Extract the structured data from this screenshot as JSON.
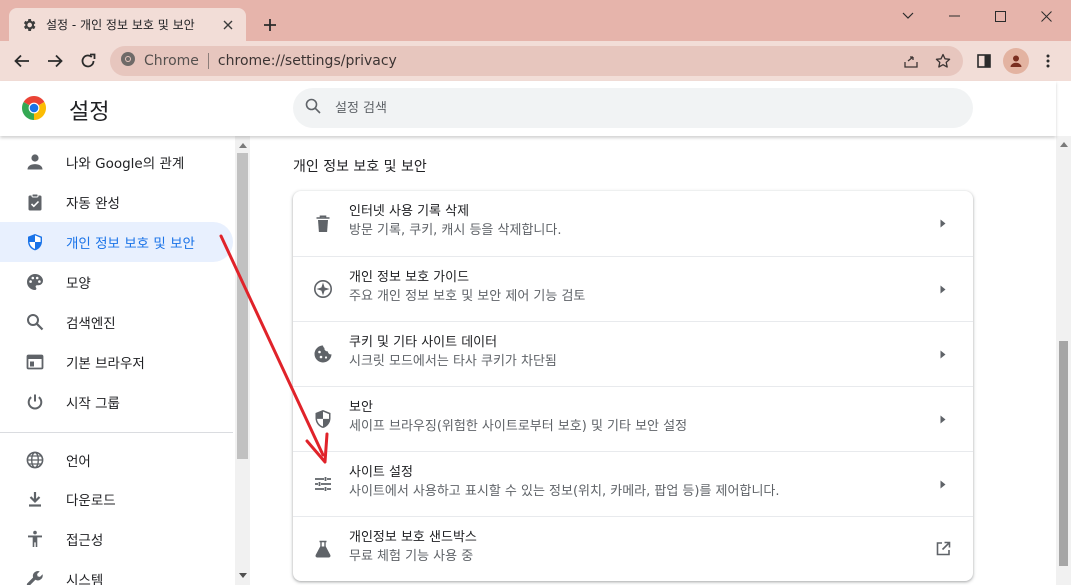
{
  "tab": {
    "title": "설정 - 개인 정보 보호 및 보안",
    "icon": "gear-icon"
  },
  "window_controls": [
    "chevron-down-icon",
    "minimize-icon",
    "maximize-icon",
    "close-icon"
  ],
  "toolbar": {
    "site_label": "Chrome",
    "url": "chrome://settings/privacy"
  },
  "header": {
    "title": "설정",
    "search_placeholder": "설정 검색"
  },
  "sidebar": {
    "items": [
      {
        "label": "나와 Google의 관계",
        "icon": "person-icon",
        "active": false
      },
      {
        "label": "자동 완성",
        "icon": "clipboard-icon",
        "active": false
      },
      {
        "label": "개인 정보 보호 및 보안",
        "icon": "shield-icon",
        "active": true
      },
      {
        "label": "모양",
        "icon": "palette-icon",
        "active": false
      },
      {
        "label": "검색엔진",
        "icon": "search-icon",
        "active": false
      },
      {
        "label": "기본 브라우저",
        "icon": "browser-icon",
        "active": false
      },
      {
        "label": "시작 그룹",
        "icon": "power-icon",
        "active": false
      },
      {
        "label": "언어",
        "icon": "globe-icon",
        "active": false
      },
      {
        "label": "다운로드",
        "icon": "download-icon",
        "active": false
      },
      {
        "label": "접근성",
        "icon": "accessibility-icon",
        "active": false
      },
      {
        "label": "시스템",
        "icon": "wrench-icon",
        "active": false
      }
    ]
  },
  "main": {
    "section_title": "개인 정보 보호 및 보안",
    "rows": [
      {
        "title": "인터넷 사용 기록 삭제",
        "subtitle": "방문 기록, 쿠키, 캐시 등을 삭제합니다.",
        "icon": "trash-icon",
        "action": "arrow"
      },
      {
        "title": "개인 정보 보호 가이드",
        "subtitle": "주요 개인 정보 보호 및 보안 제어 기능 검토",
        "icon": "compass-icon",
        "action": "arrow"
      },
      {
        "title": "쿠키 및 기타 사이트 데이터",
        "subtitle": "시크릿 모드에서는 타사 쿠키가 차단됨",
        "icon": "cookie-icon",
        "action": "arrow"
      },
      {
        "title": "보안",
        "subtitle": "세이프 브라우징(위험한 사이트로부터 보호) 및 기타 보안 설정",
        "icon": "shield-icon",
        "action": "arrow"
      },
      {
        "title": "사이트 설정",
        "subtitle": "사이트에서 사용하고 표시할 수 있는 정보(위치, 카메라, 팝업 등)를 제어합니다.",
        "icon": "tune-icon",
        "action": "arrow"
      },
      {
        "title": "개인정보 보호 샌드박스",
        "subtitle": "무료 체험 기능 사용 중",
        "icon": "flask-icon",
        "action": "external"
      }
    ]
  },
  "colors": {
    "titlebar": "#e6b4ab",
    "toolbar": "#f2ddd7",
    "accent": "#1a73e8",
    "annotation_arrow": "#e0232a"
  }
}
